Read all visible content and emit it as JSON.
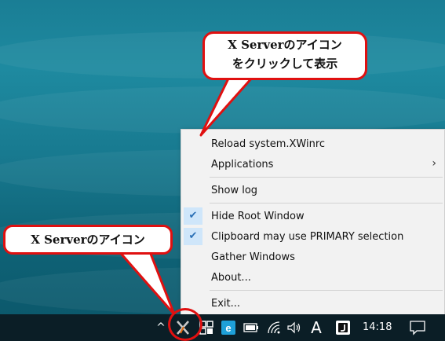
{
  "callouts": {
    "top_line1": "X Serverのアイコン",
    "top_line2": "をクリックして表示",
    "bottom": "X Serverのアイコン"
  },
  "menu": {
    "items": [
      {
        "label": "Reload system.XWinrc",
        "checked": false,
        "submenu": false
      },
      {
        "label": "Applications",
        "checked": false,
        "submenu": true
      },
      {
        "label": "Show log",
        "checked": false,
        "submenu": false
      },
      {
        "label": "Hide Root Window",
        "checked": true,
        "submenu": false
      },
      {
        "label": "Clipboard may use PRIMARY selection",
        "checked": true,
        "submenu": false
      },
      {
        "label": "Gather Windows",
        "checked": false,
        "submenu": false
      },
      {
        "label": "About...",
        "checked": false,
        "submenu": false
      },
      {
        "label": "Exit...",
        "checked": false,
        "submenu": false
      }
    ],
    "check_glyph": "✔",
    "submenu_glyph": "›"
  },
  "taskbar": {
    "chevron": "^",
    "ime_label": "A",
    "clock": "14:18"
  },
  "colors": {
    "callout_border": "#e01010",
    "menu_background": "#f2f2f2",
    "check_highlight": "#cfe6fa",
    "taskbar": "#0b1e26"
  }
}
